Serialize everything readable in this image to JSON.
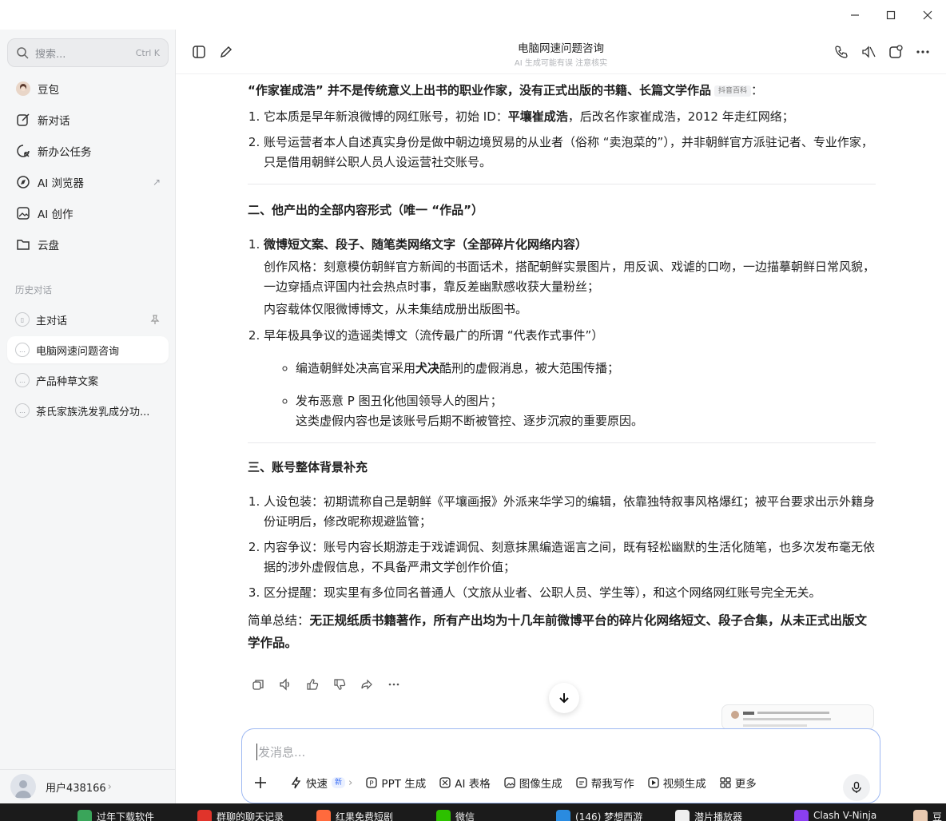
{
  "window": {
    "controls": {
      "minimize": "—",
      "maximize": "☐",
      "close": "✕"
    }
  },
  "sidebar": {
    "search": {
      "placeholder": "搜索...",
      "shortcut": "Ctrl K"
    },
    "nav": [
      {
        "label": "豆包",
        "icon": "doubao-avatar-icon"
      },
      {
        "label": "新对话",
        "icon": "new-chat-icon"
      },
      {
        "label": "新办公任务",
        "icon": "office-task-icon"
      },
      {
        "label": "AI 浏览器",
        "icon": "compass-icon",
        "trail": "↗"
      },
      {
        "label": "AI 创作",
        "icon": "image-create-icon"
      },
      {
        "label": "云盘",
        "icon": "folder-icon"
      }
    ],
    "history_label": "历史对话",
    "history": [
      {
        "label": "主对话",
        "pinned": true
      },
      {
        "label": "电脑网速问题咨询",
        "active": true
      },
      {
        "label": "产品种草文案"
      },
      {
        "label": "茶氏家族洗发乳成分功..."
      }
    ],
    "user": {
      "name": "用户438166",
      "chevron": "›"
    }
  },
  "header": {
    "title": "电脑网速问题咨询",
    "subtitle": "AI 生成可能有误 注意核实"
  },
  "message": {
    "intro_bold": "“作家崔成浩” 并不是传统意义上出书的职业作家，没有正式出版的书籍、长篇文学作品",
    "intro_tag": "抖音百科",
    "intro_colon": "：",
    "list1": [
      {
        "pre": "它本质是早年新浪微博的网红账号，初始 ID：",
        "bold": "平壤崔成浩",
        "post": "，后改名作家崔成浩，2012 年走红网络；"
      },
      {
        "pre": "账号运营者本人自述真实身份是做中朝边境贸易的从业者（俗称 “卖泡菜的”），并非朝鲜官方派驻记者、专业作家，只是借用朝鲜公职人员人设运营社交账号。"
      }
    ],
    "section2_title": "二、他产出的全部内容形式（唯一 “作品”）",
    "s2_item1_title": "微博短文案、段子、随笔类网络文字（全部碎片化网络内容）",
    "s2_item1_p1": "创作风格：刻意模仿朝鲜官方新闻的书面话术，搭配朝鲜实景图片，用反讽、戏谑的口吻，一边描摹朝鲜日常风貌，一边穿插点评国内社会热点时事，靠反差幽默感收获大量粉丝；",
    "s2_item1_p2": "内容载体仅限微博博文，从未集结成册出版图书。",
    "s2_item2_title": "早年极具争议的造谣类博文（流传最广的所谓 “代表作式事件”）",
    "s2_sub1_pre": "编造朝鲜处决高官采用",
    "s2_sub1_bold": "犬决",
    "s2_sub1_post": "酷刑的虚假消息，被大范围传播；",
    "s2_sub2_line1": "发布恶意 P 图丑化他国领导人的图片；",
    "s2_sub2_line2": "这类虚假内容也是该账号后期不断被管控、逐步沉寂的重要原因。",
    "section3_title": "三、账号整体背景补充",
    "list3": [
      "人设包装：初期谎称自己是朝鲜《平壤画报》外派来华学习的编辑，依靠独特叙事风格爆红；被平台要求出示外籍身份证明后，修改昵称规避监管；",
      "内容争议：账号内容长期游走于戏谑调侃、刻意抹黑编造谣言之间，既有轻松幽默的生活化随笔，也多次发布毫无依据的涉外虚假信息，不具备严肃文学创作价值；",
      "区分提醒：现实里有多位同名普通人（文旅从业者、公职人员、学生等），和这个网络网红账号完全无关。"
    ],
    "summary_pre": "简单总结：",
    "summary_bold": "无正规纸质书籍著作，所有产出均为十几年前微博平台的碎片化网络短文、段子合集，从未正式出版文学作品。"
  },
  "composer": {
    "placeholder": "发消息...",
    "tools": [
      {
        "label": "快速",
        "badge": "新",
        "chevron": "›",
        "icon": "lightning-icon"
      },
      {
        "label": "PPT 生成",
        "icon": "ppt-icon"
      },
      {
        "label": "AI 表格",
        "icon": "table-icon"
      },
      {
        "label": "图像生成",
        "icon": "image-icon"
      },
      {
        "label": "帮我写作",
        "icon": "write-icon"
      },
      {
        "label": "视频生成",
        "icon": "video-icon"
      },
      {
        "label": "更多",
        "icon": "grid-icon"
      }
    ]
  },
  "taskbar": [
    {
      "label": "过年下载软件",
      "color": "#3aa55a"
    },
    {
      "label": "群聊的聊天记录",
      "color": "#e0342b"
    },
    {
      "label": "红果免费短剧",
      "color": "#ff6a3d"
    },
    {
      "label": "微信",
      "color": "#2dc100"
    },
    {
      "label": "(146) 梦想西游",
      "color": "#2a8be0"
    },
    {
      "label": "潜片播放器",
      "color": "#f0f0f0"
    },
    {
      "label": "Clash V-Ninja",
      "color": "#8a3ff0"
    },
    {
      "label": "豆",
      "color": "#e8c9b0"
    }
  ]
}
